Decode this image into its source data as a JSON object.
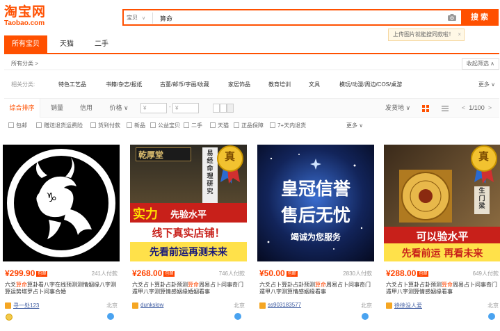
{
  "header": {
    "logo_cn": "淘宝网",
    "logo_en": "Taobao.com",
    "search": {
      "scope": "宝贝",
      "query": "算命",
      "button": "搜索"
    },
    "image_tip": "上传图片就能搜同款啦！",
    "tip_close": "×"
  },
  "tabs": [
    {
      "label": "所有宝贝",
      "active": true
    },
    {
      "label": "天猫",
      "active": false
    },
    {
      "label": "二手",
      "active": false
    }
  ],
  "category": {
    "all": "所有分类 >",
    "collapse": "收起筛选 ∧"
  },
  "related": {
    "label": "相关分类:",
    "items": [
      "特色工艺品",
      "书籍/杂志/报纸",
      "古董/邮币/字画/收藏",
      "家居饰品",
      "教育培训",
      "文具",
      "模玩/动漫/周边/COS/桌游"
    ],
    "more": "更多 ∨"
  },
  "sort": {
    "items": [
      "综合排序",
      "销量",
      "信用",
      "价格 ∨"
    ],
    "price_from": "¥",
    "price_to": "¥",
    "dash": "-",
    "ship": "发货地 ∨",
    "pager": "1/100",
    "prev": "<",
    "next": ">"
  },
  "filters": [
    "包邮",
    "赠送退货运费险",
    "货到付款",
    "新品",
    "公益宝贝",
    "二手",
    "天猫",
    "正品保障",
    "7+天内退货"
  ],
  "filters_more": "更多 ∨",
  "products": [
    {
      "price": "¥299.90",
      "badge": "包邮",
      "sales": "241人付款",
      "title_pre": "六爻",
      "title_hl": "算命",
      "title_post": "算卦看八字在线预测测情姻缘八字测算运势塔罗占卜问事合婚",
      "shop": "寻一处123",
      "location": "北京"
    },
    {
      "price": "¥268.00",
      "badge": "包邮",
      "sales": "746人付款",
      "title_pre": "六爻占卜算卦占卦预测",
      "title_hl": "算命",
      "title_post": "周易占卜问事奇门遁甲八字测算情感姻缘婚姻看事",
      "shop": "dunkslow",
      "location": "北京",
      "img_sign": "乾厚堂",
      "img_banner1a": "实力",
      "img_banner1b": "先验水平",
      "img_banner2": "线下真实店铺！",
      "img_banner3": "先看前运再测未来",
      "img_side": "易经命理研究",
      "img_medal": "真"
    },
    {
      "price": "¥50.00",
      "badge": "包邮",
      "sales": "2830人付款",
      "title_pre": "六爻占卜算卦占卦预测",
      "title_hl": "算命",
      "title_post": "周易占卜问事奇门遁甲八字测算情感姻缘看事",
      "shop": "ss903183577",
      "location": "北京",
      "img_line1": "皇冠信誉",
      "img_line2": "售后无忧",
      "img_line3": "竭诚为您服务"
    },
    {
      "price": "¥288.00",
      "badge": "包邮",
      "sales": "649人付款",
      "title_pre": "六爻占卜算卦占卦预测",
      "title_hl": "算命",
      "title_post": "周易占卜问事奇门遁甲八字测算情感姻缘看事",
      "shop": "徐徐没人爱",
      "location": "北京",
      "img_banner1": "可以验水平",
      "img_banner2": "先看前运 再看未来",
      "img_side": "生门梁",
      "img_medal": "真"
    }
  ],
  "colors": {
    "accent": "#ff5000",
    "price": "#ff4400",
    "link": "#3c5aa0"
  }
}
